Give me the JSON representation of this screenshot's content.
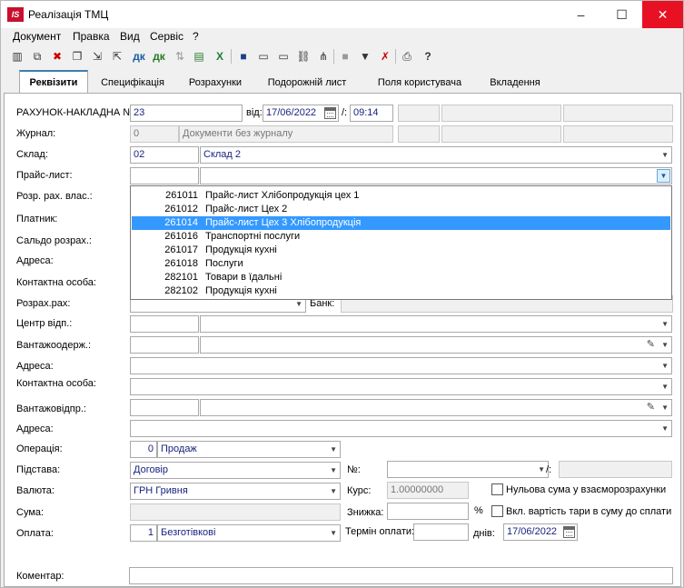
{
  "window": {
    "title": "Реалізація ТМЦ",
    "icon_text": "IS",
    "controls": [
      "–",
      "☐",
      "✕"
    ]
  },
  "menu": [
    "Документ",
    "Правка",
    "Вид",
    "Сервіс",
    "?"
  ],
  "toolbar": {
    "icons": [
      "new-doc-icon",
      "copy-icon",
      "delete-icon",
      "duplicate-icon",
      "import-icon",
      "export-icon",
      "dk-icon",
      "dk-alt-icon",
      "transfer-icon",
      "print-preview-icon",
      "export-excel-icon",
      "save-icon",
      "book-icon",
      "book-open-icon",
      "link-icon",
      "tree-icon",
      "grid-icon",
      "filter-icon",
      "filter-clear-icon",
      "printer-icon",
      "help-icon"
    ],
    "dk_label": "дк"
  },
  "tabs": [
    "Реквізити",
    "Специфікація",
    "Розрахунки",
    "Подорожній лист",
    "Поля користувача",
    "Вкладення"
  ],
  "form": {
    "invoice_label": "РАХУНОК-НАКЛАДНА №:",
    "invoice_number": "23",
    "date_label": "від:",
    "date": "17/06/2022",
    "time_sep": "/:",
    "time": "09:14",
    "journal_label": "Журнал:",
    "journal_code": "0",
    "journal_name": "Документи без журналу",
    "warehouse_label": "Склад:",
    "warehouse_code": "02",
    "warehouse_name": "Склад 2",
    "pricelist_label": "Прайс-лист:",
    "own_account_label": "Розр. рах. влас.:",
    "payer_label": "Платник:",
    "balance_label": "Сальдо розрах.:",
    "address_label": "Адреса:",
    "contact_label": "Контактна особа:",
    "account_label": "Розрах.рах:",
    "bank_label": "Банк:",
    "center_label": "Центр відп.:",
    "consignee_label": "Вантажоодерж.:",
    "address2_label": "Адреса:",
    "contact2_label": "Контактна особа:",
    "shipper_label": "Вантажовідпр.:",
    "address3_label": "Адреса:",
    "operation_label": "Операція:",
    "operation_code": "0",
    "operation_name": "Продаж",
    "basis_label": "Підстава:",
    "basis_value": "Договір",
    "number_label": "№:",
    "slash": "/:",
    "currency_label": "Валюта:",
    "currency_value": "ГРН Гривня",
    "rate_label": "Курс:",
    "rate_value": "1.00000000",
    "zero_sum_label": "Нульова сума у взаєморозрахунки",
    "sum_label": "Сума:",
    "discount_label": "Знижка:",
    "percent": "%",
    "tare_label": "Вкл. вартість тари в суму до сплати",
    "payment_label": "Оплата:",
    "payment_code": "1",
    "payment_name": "Безготівкові",
    "term_label": "Термін оплати:",
    "days_label": "днів:",
    "term_date": "17/06/2022",
    "comment_label": "Коментар:"
  },
  "pricelist_dropdown": [
    {
      "code": "261011",
      "name": "Прайс-лист Хлібопродукція цех 1",
      "selected": false
    },
    {
      "code": "261012",
      "name": "Прайс-лист Цех 2",
      "selected": false
    },
    {
      "code": "261014",
      "name": "Прайс-лист Цех 3 Хлібопродукція",
      "selected": true
    },
    {
      "code": "261016",
      "name": "Транспортні послуги",
      "selected": false
    },
    {
      "code": "261017",
      "name": "Продукція кухні",
      "selected": false
    },
    {
      "code": "261018",
      "name": "Послуги",
      "selected": false
    },
    {
      "code": "282101",
      "name": "Товари в їдальні",
      "selected": false
    },
    {
      "code": "282102",
      "name": "Продукція кухні",
      "selected": false
    }
  ]
}
